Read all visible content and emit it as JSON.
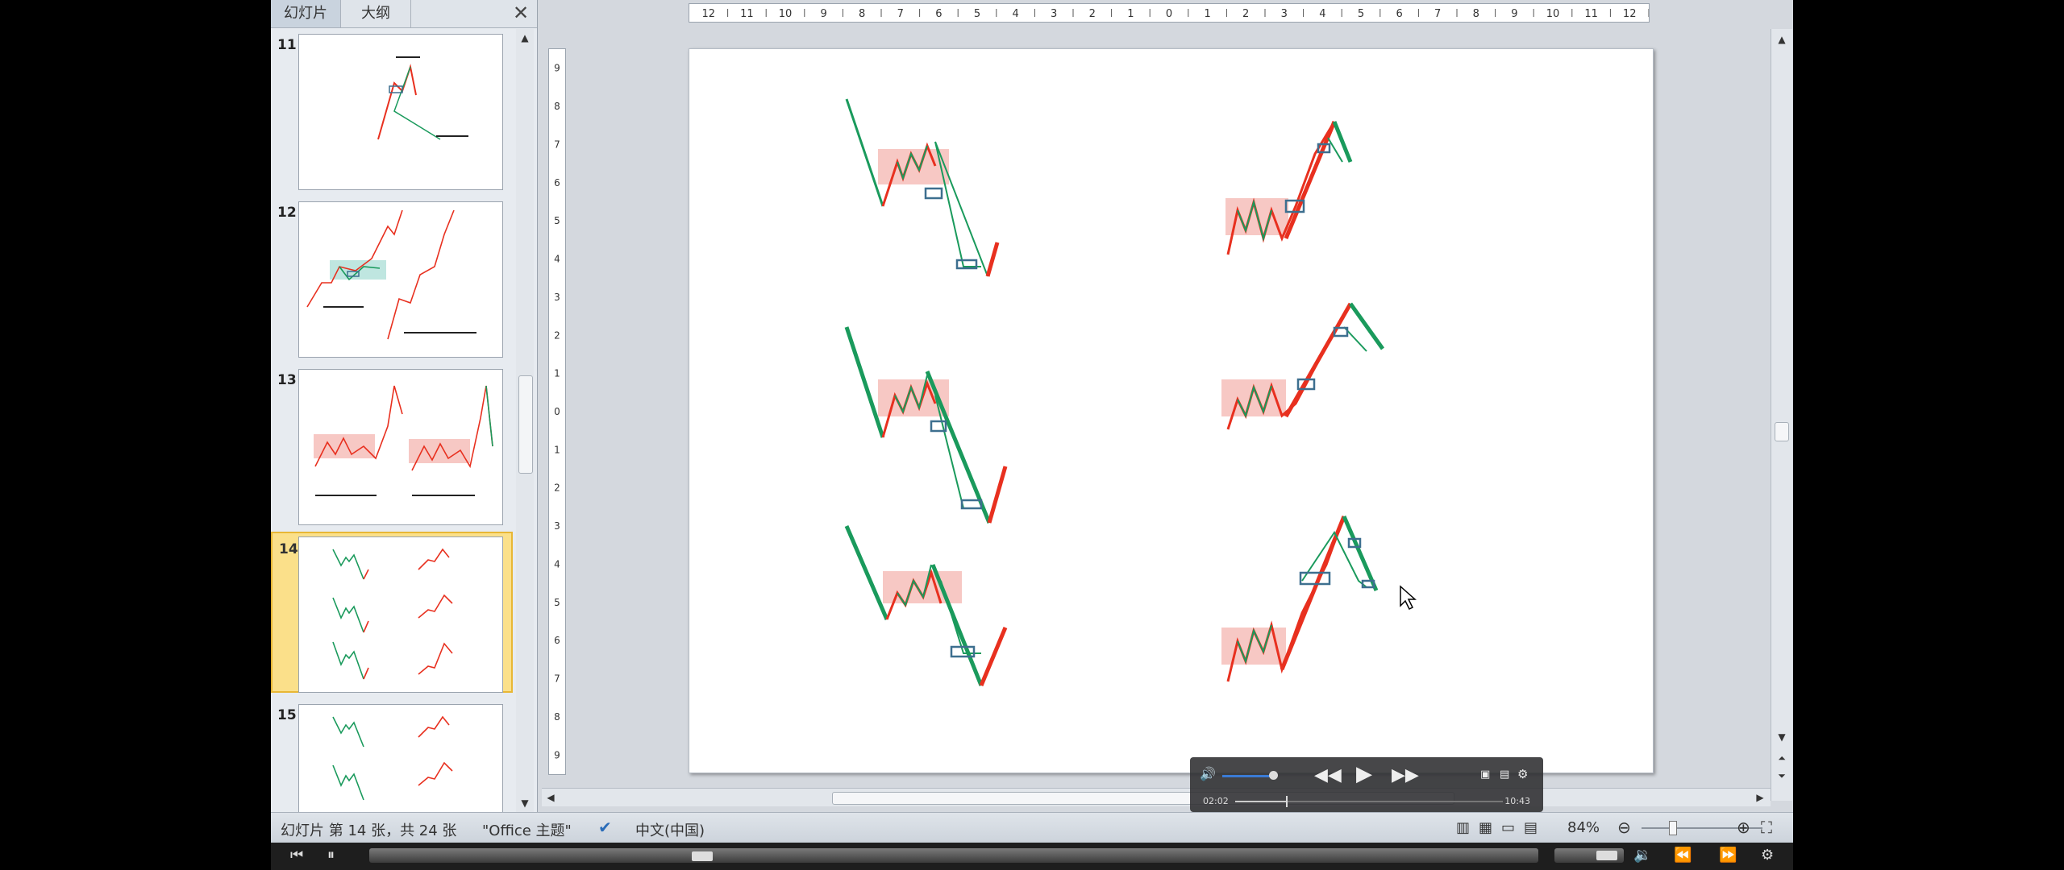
{
  "left_panel": {
    "tabs": [
      "幻灯片",
      "大纲"
    ],
    "close_glyph": "✕",
    "slides": [
      {
        "num": "11",
        "selected": false
      },
      {
        "num": "12",
        "selected": false
      },
      {
        "num": "13",
        "selected": false
      },
      {
        "num": "14",
        "selected": true
      },
      {
        "num": "15",
        "selected": false
      }
    ]
  },
  "ruler_numbers": [
    "12",
    "11",
    "10",
    "9",
    "8",
    "7",
    "6",
    "5",
    "4",
    "3",
    "2",
    "1",
    "0",
    "1",
    "2",
    "3",
    "4",
    "5",
    "6",
    "7",
    "8",
    "9",
    "10",
    "11",
    "12"
  ],
  "vruler_numbers": [
    "9",
    "8",
    "7",
    "6",
    "5",
    "4",
    "3",
    "2",
    "1",
    "0",
    "1",
    "2",
    "3",
    "4",
    "5",
    "6",
    "7",
    "8",
    "9"
  ],
  "player": {
    "current_time": "02:02",
    "total_time": "10:43",
    "progress": 0.19,
    "volume": 0.9
  },
  "status": {
    "slide_info": "幻灯片 第 14 张，共 24 张",
    "theme": "\"Office 主题\"",
    "language": "中文(中国)",
    "zoom": "84%"
  },
  "colors": {
    "up": "#e8301f",
    "down": "#1a9a5c",
    "box": "#3d6f8f",
    "highlight": "#f7c8c4",
    "selected_thumb": "#fbe08a"
  }
}
